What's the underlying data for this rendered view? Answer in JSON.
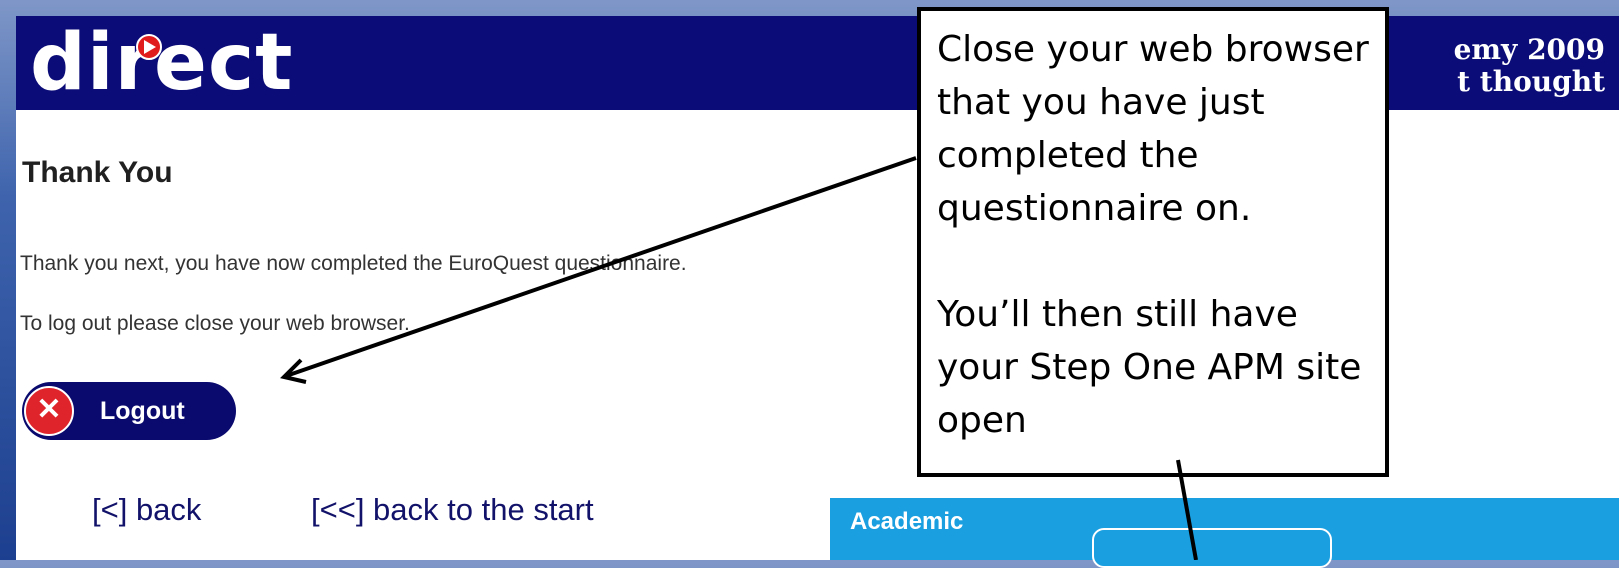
{
  "banner": {
    "logo_text": "direct",
    "tagline_line1": "emy 2009",
    "tagline_line2": "t thought"
  },
  "content": {
    "heading": "Thank You",
    "message": "Thank you next, you have now completed the EuroQuest questionnaire.",
    "logout_instruction": "To log out please close your web browser.",
    "logout_button": "Logout",
    "back_link": "[<] back",
    "back_to_start_link": "[<<] back to the start"
  },
  "callout": {
    "paragraph1": "Close your web browser that you have just completed the questionnaire on.",
    "paragraph2": "You’ll then still have your Step One APM site open"
  },
  "academic_panel": {
    "label": "Academic"
  },
  "colors": {
    "banner": "#0c0c78",
    "logout_button": "#0a0a6e",
    "logout_icon": "#e0242b",
    "link": "#12126a",
    "academic_panel": "#1a9fe0"
  },
  "icons": {
    "logo_dot": "play-icon",
    "logout": "close-icon"
  }
}
